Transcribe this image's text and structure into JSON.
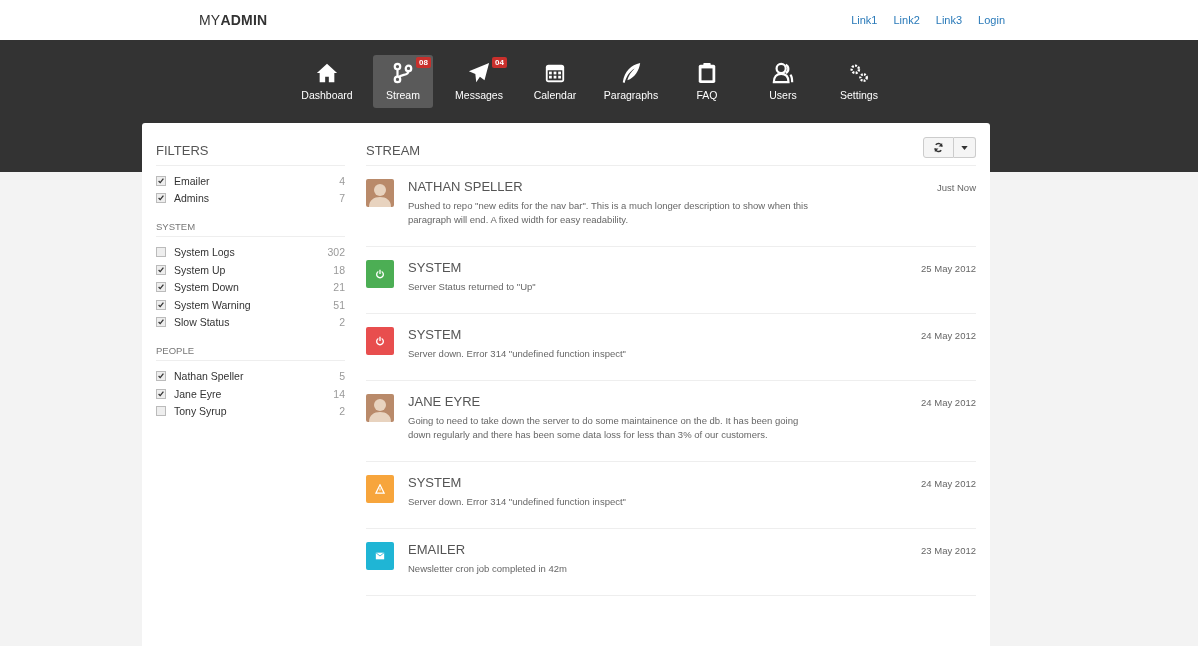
{
  "brand": "MY**ADMIN**",
  "top_links": [
    "Link1",
    "Link2",
    "Link3",
    "Login"
  ],
  "nav": [
    {
      "label": "Dashboard",
      "selected": false
    },
    {
      "label": "Stream",
      "selected": true,
      "badge": "08"
    },
    {
      "label": "Messages",
      "selected": false,
      "badge": "04"
    },
    {
      "label": "Calendar",
      "selected": false
    },
    {
      "label": "Paragraphs",
      "selected": false
    },
    {
      "label": "FAQ",
      "selected": false
    },
    {
      "label": "Users",
      "selected": false
    },
    {
      "label": "Settings",
      "selected": false
    }
  ],
  "filters": {
    "title": "FILTERS",
    "groups": [
      {
        "items": [
          {
            "label": "Emailer",
            "count": "4",
            "checked": true
          },
          {
            "label": "Admins",
            "count": "7",
            "checked": true
          }
        ]
      },
      {
        "heading": "SYSTEM",
        "items": [
          {
            "label": "System Logs",
            "count": "302",
            "checked": false
          },
          {
            "label": "System Up",
            "count": "18",
            "checked": true
          },
          {
            "label": "System Down",
            "count": "21",
            "checked": true
          },
          {
            "label": "System Warning",
            "count": "51",
            "checked": true
          },
          {
            "label": "Slow Status",
            "count": "2",
            "checked": true
          }
        ]
      },
      {
        "heading": "PEOPLE",
        "items": [
          {
            "label": "Nathan Speller",
            "count": "5",
            "checked": true
          },
          {
            "label": "Jane Eyre",
            "count": "14",
            "checked": true
          },
          {
            "label": "Tony Syrup",
            "count": "2",
            "checked": false
          }
        ]
      }
    ]
  },
  "stream": {
    "title": "STREAM",
    "items": [
      {
        "kind": "photo",
        "title": "NATHAN SPELLER",
        "time": "Just Now",
        "text": "Pushed to repo \"new edits for the nav bar\". This is a much longer description to show when this paragraph will end. A fixed width for easy readability."
      },
      {
        "kind": "power",
        "color": "#4cae54",
        "title": "SYSTEM",
        "time": "25 May 2012",
        "text": "Server Status returned to \"Up\""
      },
      {
        "kind": "power",
        "color": "#e84e4e",
        "title": "SYSTEM",
        "time": "24 May 2012",
        "text": "Server down. Error 314 \"undefined function inspect\""
      },
      {
        "kind": "photo",
        "title": "JANE EYRE",
        "time": "24 May 2012",
        "text": "Going to need to take down the server to do some maintainence on the db. It has been going down regularly and there has been some data loss for less than 3% of our customers."
      },
      {
        "kind": "warning",
        "color": "#f7a53c",
        "title": "SYSTEM",
        "time": "24 May 2012",
        "text": "Server down. Error 314 \"undefined function inspect\""
      },
      {
        "kind": "mail",
        "color": "#1fb5d5",
        "title": "EMAILER",
        "time": "23 May 2012",
        "text": "Newsletter cron job completed in 42m"
      }
    ]
  }
}
